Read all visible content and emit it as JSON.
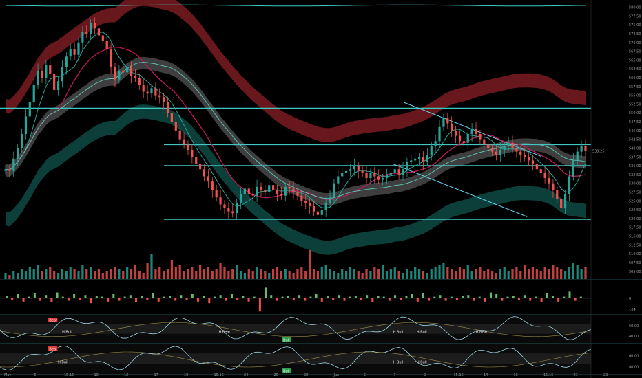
{
  "chart_data": {
    "type": "candlestick",
    "price_scale": {
      "ylim": [
        503.0,
        580.5
      ],
      "ticks": [
        "580.00",
        "577.50",
        "575.00",
        "572.50",
        "570.00",
        "567.50",
        "565.00",
        "562.50",
        "560.00",
        "557.50",
        "555.00",
        "552.50",
        "550.00",
        "547.50",
        "545.00",
        "542.50",
        "540.00",
        "537.50",
        "535.00",
        "532.50",
        "530.00",
        "527.50",
        "525.00",
        "522.50",
        "520.00",
        "517.50",
        "515.00",
        "512.50",
        "510.00",
        "507.50",
        "505.00"
      ],
      "last_price": "539.25"
    },
    "x_ticks": [
      "May",
      "5",
      "15:15",
      "10",
      "12",
      "17",
      "19",
      "15:15",
      "24",
      "26",
      "28",
      "Jun",
      "5",
      "7",
      "9",
      "15:15",
      "14",
      "16",
      "15:15",
      "21",
      "23"
    ],
    "horizontal_levels": [
      551.3,
      541.0,
      535.0,
      519.8
    ],
    "trend_lines": [
      {
        "x1": 0.683,
        "y1": 553.0,
        "x2": 0.915,
        "y2": 537.7
      },
      {
        "x1": 0.665,
        "y1": 535.5,
        "x2": 0.892,
        "y2": 520.5
      }
    ],
    "candles_close": [
      534.0,
      533.5,
      537.0,
      540.0,
      544.0,
      549.0,
      553.0,
      558.0,
      562.0,
      560.0,
      563.5,
      561.0,
      556.5,
      559.0,
      563.0,
      566.0,
      568.0,
      566.5,
      570.0,
      573.0,
      572.5,
      575.5,
      574.0,
      572.0,
      570.5,
      568.0,
      563.0,
      559.5,
      562.0,
      561.5,
      563.0,
      560.5,
      560.0,
      558.0,
      556.0,
      555.5,
      557.0,
      555.0,
      554.5,
      553.0,
      550.0,
      547.5,
      545.0,
      542.5,
      541.0,
      539.5,
      537.5,
      535.5,
      534.0,
      532.0,
      530.5,
      528.0,
      526.0,
      524.0,
      523.0,
      522.0,
      521.5,
      524.5,
      527.0,
      528.5,
      527.0,
      526.5,
      529.0,
      528.0,
      527.5,
      529.5,
      528.0,
      527.0,
      526.5,
      529.0,
      528.5,
      527.5,
      526.5,
      525.0,
      524.5,
      523.5,
      522.0,
      521.0,
      522.5,
      524.5,
      526.0,
      530.0,
      532.0,
      533.0,
      533.5,
      534.0,
      535.0,
      533.5,
      533.0,
      531.5,
      533.0,
      532.0,
      531.0,
      531.5,
      532.5,
      533.0,
      534.0,
      532.5,
      534.0,
      536.0,
      536.5,
      537.0,
      537.5,
      536.0,
      538.0,
      540.5,
      542.0,
      546.0,
      548.5,
      547.0,
      545.0,
      543.5,
      542.0,
      541.5,
      544.0,
      545.5,
      544.0,
      542.5,
      541.0,
      540.0,
      539.0,
      538.0,
      539.5,
      540.5,
      541.5,
      540.0,
      539.0,
      538.0,
      537.5,
      536.5,
      535.5,
      534.0,
      533.0,
      531.5,
      530.0,
      528.0,
      525.5,
      523.0,
      527.0,
      532.0,
      536.5,
      539.0,
      540.5,
      539.25
    ],
    "volume": [
      3,
      2,
      4,
      3,
      5,
      4,
      6,
      5,
      7,
      4,
      5,
      6,
      4,
      3,
      5,
      4,
      6,
      5,
      4,
      7,
      5,
      6,
      4,
      5,
      3,
      4,
      5,
      6,
      5,
      4,
      6,
      5,
      7,
      4,
      3,
      8,
      12,
      5,
      6,
      4,
      5,
      9,
      6,
      7,
      4,
      5,
      6,
      4,
      7,
      5,
      6,
      4,
      5,
      8,
      6,
      4,
      5,
      7,
      4,
      3,
      5,
      4,
      6,
      5,
      4,
      3,
      5,
      6,
      4,
      5,
      4,
      3,
      5,
      6,
      4,
      14,
      5,
      4,
      6,
      7,
      5,
      4,
      3,
      5,
      4,
      6,
      5,
      4,
      3,
      5,
      4,
      6,
      5,
      7,
      4,
      5,
      6,
      4,
      3,
      5,
      4,
      6,
      5,
      4,
      3,
      5,
      6,
      7,
      8,
      6,
      5,
      4,
      6,
      5,
      7,
      4,
      5,
      6,
      4,
      5,
      4,
      3,
      5,
      6,
      4,
      5,
      6,
      4,
      7,
      5,
      6,
      5,
      4,
      6,
      5,
      7,
      6,
      5,
      4,
      6,
      8,
      7,
      5,
      6
    ],
    "histogram": [
      0.3,
      -0.2,
      0.5,
      -0.4,
      0.2,
      0.6,
      -0.3,
      0.4,
      -0.5,
      0.7,
      0.2,
      -0.3,
      0.5,
      -0.2,
      0.4,
      -0.6,
      0.3,
      0.2,
      -0.4,
      0.5,
      -0.3,
      0.2,
      0.4,
      -0.5,
      0.3,
      -0.2,
      0.6,
      -0.4,
      0.2,
      0.3,
      -0.3,
      0.4,
      -0.2,
      0.5,
      -0.4,
      0.3,
      -0.6,
      0.2,
      0.4,
      -0.3,
      0.5,
      -0.2,
      0.3,
      -0.4,
      0.2,
      -1.6,
      1.3,
      0.4,
      -0.3,
      0.2,
      0.3,
      -0.2,
      0.4,
      -0.3,
      0.2,
      0.5,
      -0.4,
      0.3,
      -0.2,
      0.4,
      -0.3,
      0.2,
      0.3,
      -0.2,
      0.4,
      -0.5,
      0.3,
      0.2,
      -0.3,
      0.4,
      -0.2,
      0.3,
      0.5,
      -0.4,
      0.6,
      -0.3,
      0.2,
      0.4,
      -0.3,
      0.2,
      -0.2,
      0.3,
      0.4,
      -0.3,
      0.2,
      -0.4,
      0.7,
      0.5,
      -0.3,
      0.2,
      0.3,
      -0.2,
      0.4,
      -0.3,
      0.2,
      -0.5,
      0.6,
      0.3,
      -0.4,
      0.2,
      0.8,
      -0.3,
      0.2
    ],
    "histogram_scale": [
      "0",
      "-.04"
    ],
    "osc_scale_1": [
      "60.00",
      "40.00"
    ],
    "osc_scale_2": [
      "60.00",
      "40.00"
    ],
    "annotations_1": [
      {
        "text": "Bear",
        "x": 0.082,
        "kind": "box-red"
      },
      {
        "text": "H Bull",
        "x": 0.105,
        "kind": "text"
      },
      {
        "text": "H Bear",
        "x": 0.37,
        "kind": "text"
      },
      {
        "text": "Bull",
        "x": 0.478,
        "kind": "box-green"
      },
      {
        "text": "H Bull",
        "x": 0.665,
        "kind": "text"
      },
      {
        "text": "H Bull",
        "x": 0.705,
        "kind": "text"
      },
      {
        "text": "H Bear",
        "x": 0.805,
        "kind": "text"
      }
    ],
    "annotations_2": [
      {
        "text": "Bear",
        "x": 0.082,
        "kind": "box-red"
      },
      {
        "text": "H Bull",
        "x": 0.098,
        "kind": "text"
      },
      {
        "text": "H Bull",
        "x": 0.665,
        "kind": "text"
      },
      {
        "text": "H Bull",
        "x": 0.705,
        "kind": "text"
      },
      {
        "text": "Bull",
        "x": 0.478,
        "kind": "box-green"
      }
    ],
    "colors": {
      "up": "#26a69a",
      "down": "#ef5350",
      "level": "#3fc9c3",
      "trend": "#5fd3ef",
      "ma_pink": "#c2185b",
      "ma_teal": "#26a69a",
      "band_red": "#7a1c22",
      "band_teal": "#0f4a44",
      "band_gray": "#8a8a8a"
    }
  }
}
